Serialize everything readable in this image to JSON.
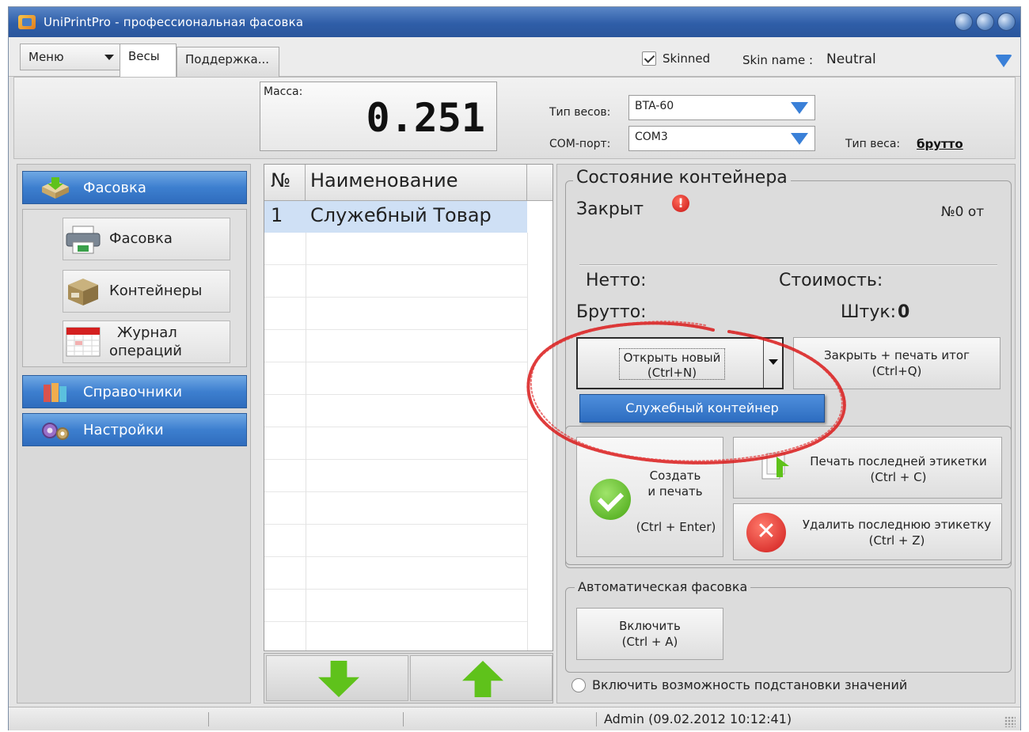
{
  "window": {
    "title": "UniPrintPro - профессиональная фасовка"
  },
  "tabbar": {
    "menu_label": "Меню",
    "tabs": [
      {
        "label": "Весы",
        "active": true
      },
      {
        "label": "Поддержка...",
        "active": false
      }
    ],
    "skinned_label": "Skinned",
    "skinned_checked": true,
    "skin_name_label": "Skin name :",
    "skin_name_value": "Neutral"
  },
  "header": {
    "mass_label": "Масса:",
    "mass_value": "0.251",
    "scale_type_label": "Тип весов:",
    "scale_type_value": "BTA-60",
    "com_port_label": "COM-порт:",
    "com_port_value": "COM3",
    "weight_type_label": "Тип веса:",
    "weight_type_value": "брутто"
  },
  "sidebar": {
    "sections": [
      {
        "label": "Фасовка",
        "expanded": true
      },
      {
        "label": "Справочники",
        "expanded": false
      },
      {
        "label": "Настройки",
        "expanded": false
      }
    ],
    "items": [
      {
        "label": "Фасовка"
      },
      {
        "label": "Контейнеры"
      },
      {
        "label_line1": "Журнал",
        "label_line2": "операций"
      }
    ]
  },
  "product_table": {
    "columns": [
      "№",
      "Наименование"
    ],
    "rows": [
      {
        "num": "1",
        "name": "Служебный Товар",
        "selected": true
      }
    ]
  },
  "container": {
    "group_title": "Состояние контейнера",
    "status": "Закрыт",
    "number_text": "№0 от",
    "net_label": "Нетто:",
    "cost_label": "Стоимость:",
    "gross_label": "Брутто:",
    "pieces_label": "Штук:",
    "pieces_value": "0",
    "open_new_label": "Открыть новый",
    "open_new_hotkey": "(Ctrl+N)",
    "close_print_label": "Закрыть + печать итог",
    "close_print_hotkey": "(Ctrl+Q)",
    "dropdown_option": "Служебный контейнер"
  },
  "labels": {
    "create_print_line1": "Создать",
    "create_print_line2": "и печать",
    "create_print_hotkey": "(Ctrl + Enter)",
    "print_last_label": "Печать последней этикетки",
    "print_last_hotkey": "(Ctrl + C)",
    "delete_last_label": "Удалить последнюю этикетку",
    "delete_last_hotkey": "(Ctrl + Z)"
  },
  "auto_packing": {
    "group_title": "Автоматическая фасовка",
    "enable_label": "Включить",
    "enable_hotkey": "(Ctrl + A)",
    "substitution_label": "Включить возможность подстановки значений",
    "substitution_checked": false
  },
  "statusbar": {
    "user_text": "Admin (09.02.2012 10:12:41)"
  },
  "colors": {
    "accent": "#3d7fcf",
    "titlebar": "#2f5ea8",
    "selection": "#cfe0f5",
    "annotation": "#d91a1a",
    "ok_green": "#46a512",
    "error_red": "#cf1c1c"
  }
}
